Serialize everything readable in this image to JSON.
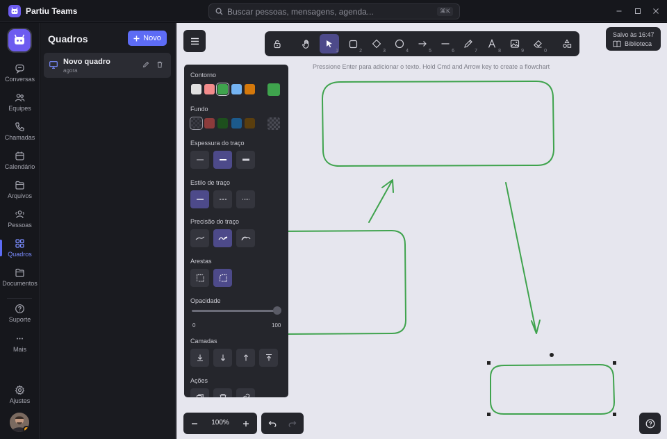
{
  "app": {
    "title": "Partiu Teams"
  },
  "search": {
    "placeholder": "Buscar pessoas, mensagens, agenda...",
    "shortcut": "⌘K"
  },
  "rail": {
    "items": [
      {
        "label": "Conversas",
        "icon": "chat-icon"
      },
      {
        "label": "Equipes",
        "icon": "teams-icon"
      },
      {
        "label": "Chamadas",
        "icon": "phone-icon"
      },
      {
        "label": "Calendário",
        "icon": "calendar-icon"
      },
      {
        "label": "Arquivos",
        "icon": "folder-icon"
      },
      {
        "label": "Pessoas",
        "icon": "people-icon"
      },
      {
        "label": "Quadros",
        "icon": "grid-icon",
        "active": true
      },
      {
        "label": "Documentos",
        "icon": "document-icon"
      },
      {
        "label": "Suporte",
        "icon": "help-icon"
      },
      {
        "label": "Mais",
        "icon": "more-icon"
      },
      {
        "label": "Ajustes",
        "icon": "gear-icon"
      }
    ]
  },
  "panel": {
    "title": "Quadros",
    "new_button": "Novo",
    "boards": [
      {
        "name": "Novo quadro",
        "time": "agora"
      }
    ]
  },
  "toolbar": {
    "tools": [
      {
        "name": "lock",
        "num": ""
      },
      {
        "name": "hand",
        "num": ""
      },
      {
        "name": "select",
        "num": "1",
        "active": true
      },
      {
        "name": "rectangle",
        "num": "2"
      },
      {
        "name": "diamond",
        "num": "3"
      },
      {
        "name": "ellipse",
        "num": "4"
      },
      {
        "name": "arrow",
        "num": "5"
      },
      {
        "name": "line",
        "num": "6"
      },
      {
        "name": "pencil",
        "num": "7"
      },
      {
        "name": "text",
        "num": "8"
      },
      {
        "name": "image",
        "num": "9"
      },
      {
        "name": "eraser",
        "num": "0"
      },
      {
        "name": "shapes",
        "num": ""
      }
    ]
  },
  "status": {
    "saved": "Salvo às 16:47",
    "library": "Biblioteca"
  },
  "hint": "Pressione Enter para adicionar o texto. Hold Cmd and Arrow key to create a flowchart",
  "props": {
    "stroke_label": "Contorno",
    "stroke_colors": [
      "#e0e0e0",
      "#f28b8b",
      "#3fa34d",
      "#74b3f2",
      "#d4780b"
    ],
    "stroke_selected": "#3fa34d",
    "stroke_current": "#3fa34d",
    "fill_label": "Fundo",
    "fill_colors": [
      "transparent",
      "#8c3b3b",
      "#1d4f1d",
      "#1c5a8c",
      "#5a3e0e"
    ],
    "width_label": "Espessura do traço",
    "style_label": "Estilo de traço",
    "sloppiness_label": "Precisão do traço",
    "edges_label": "Arestas",
    "opacity_label": "Opacidade",
    "opacity_value": 100,
    "opacity_min": "0",
    "opacity_max": "100",
    "layers_label": "Camadas",
    "actions_label": "Ações"
  },
  "zoom": {
    "value": "100%"
  },
  "colors": {
    "accent": "#5d6cf5",
    "stroke": "#3fa34d",
    "canvas": "#e6e6ee"
  }
}
